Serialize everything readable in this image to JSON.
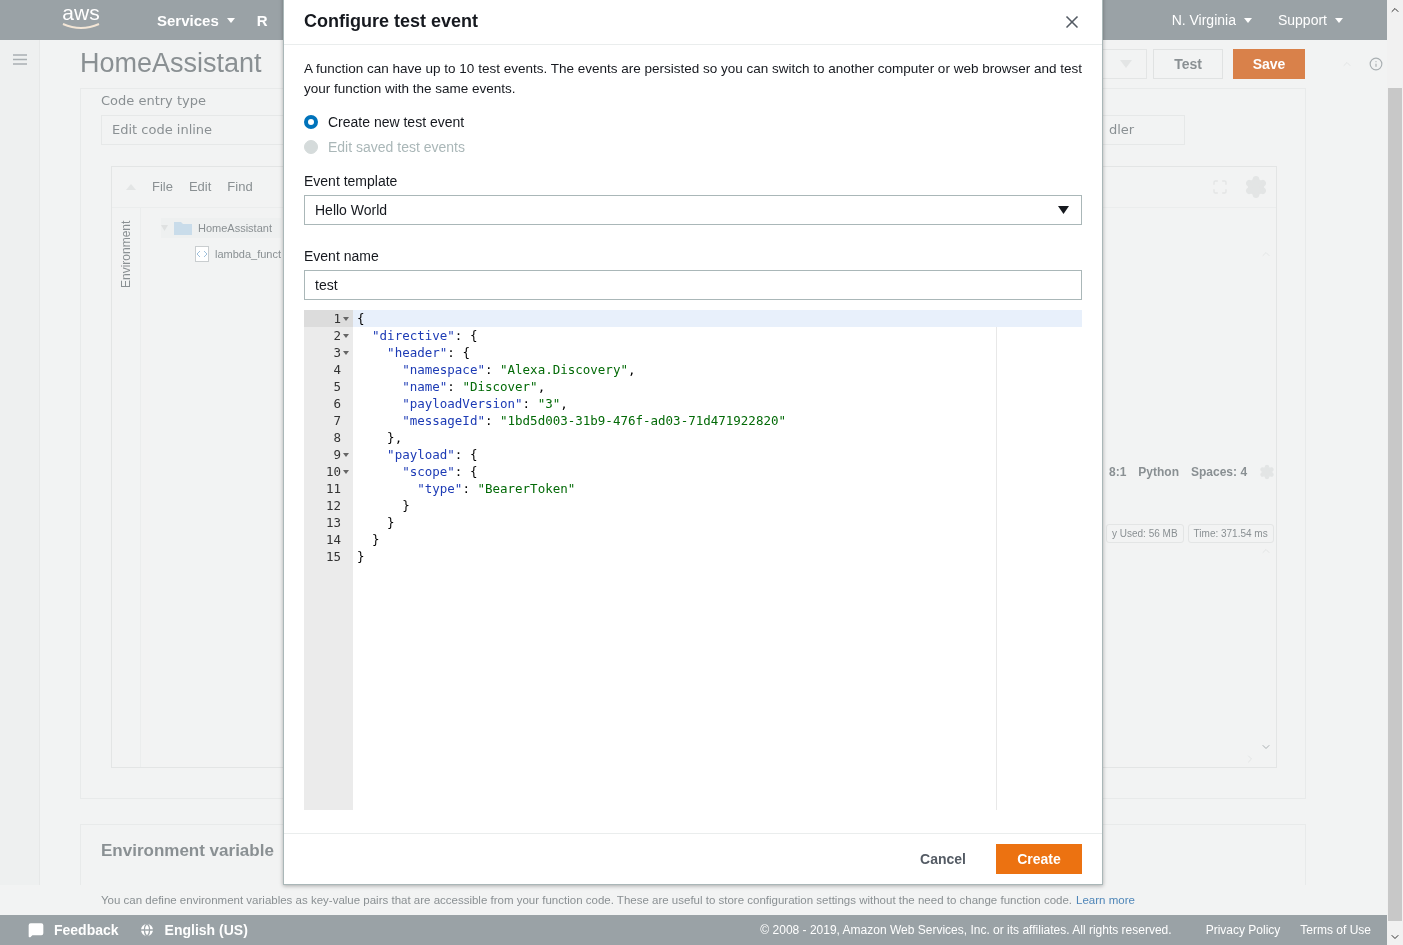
{
  "header": {
    "logo": "aws",
    "nav": [
      {
        "label": "Services",
        "caret": true
      },
      {
        "label": "R",
        "caret": false
      }
    ],
    "right": [
      {
        "label": "N. Virginia",
        "caret": true
      },
      {
        "label": "Support",
        "caret": true
      }
    ]
  },
  "page": {
    "title": "HomeAssistant",
    "actions": [
      {
        "kind": "select"
      },
      {
        "kind": "button",
        "label": "Test"
      },
      {
        "kind": "primary",
        "label": "Save"
      }
    ]
  },
  "code_card": {
    "entry_type_label": "Code entry type",
    "entry_type_value": "Edit code inline",
    "handler_value": "dler",
    "editor": {
      "menu": [
        "File",
        "Edit",
        "Find"
      ],
      "side_tab": "Environment",
      "tree": [
        {
          "label": "HomeAssistant",
          "kind": "folder",
          "expanded": true,
          "children": [
            {
              "label": "lambda_funct",
              "kind": "file"
            }
          ]
        }
      ],
      "status": [
        "8:1",
        "Python",
        "Spaces: 4"
      ],
      "result_chips": [
        "y Used: 56 MB",
        "Time: 371.54 ms"
      ]
    }
  },
  "env_card": {
    "title": "Environment variable",
    "description": "You can define environment variables as key-value pairs that are accessible from your function code. These are useful to store configuration settings without the need to change function code.",
    "link": "Learn more"
  },
  "footer": {
    "feedback": "Feedback",
    "language": "English (US)",
    "copyright": "© 2008 - 2019, Amazon Web Services, Inc. or its affiliates. All rights reserved.",
    "links": [
      "Privacy Policy",
      "Terms of Use"
    ]
  },
  "modal": {
    "title": "Configure test event",
    "intro": "A function can have up to 10 test events. The events are persisted so you can switch to another computer or web browser and test your function with the same events.",
    "options": [
      {
        "label": "Create new test event",
        "selected": true,
        "disabled": false
      },
      {
        "label": "Edit saved test events",
        "selected": false,
        "disabled": true
      }
    ],
    "template_label": "Event template",
    "template_value": "Hello World",
    "name_label": "Event name",
    "name_value": "test",
    "code": [
      {
        "n": "1",
        "text": "{",
        "fold": true,
        "active": true
      },
      {
        "n": "2",
        "text": "  \"directive\": {",
        "fold": true,
        "active": false
      },
      {
        "n": "3",
        "text": "    \"header\": {",
        "fold": true,
        "active": false
      },
      {
        "n": "4",
        "text": "      \"namespace\": \"Alexa.Discovery\",",
        "fold": false,
        "active": false
      },
      {
        "n": "5",
        "text": "      \"name\": \"Discover\",",
        "fold": false,
        "active": false
      },
      {
        "n": "6",
        "text": "      \"payloadVersion\": \"3\",",
        "fold": false,
        "active": false
      },
      {
        "n": "7",
        "text": "      \"messageId\": \"1bd5d003-31b9-476f-ad03-71d471922820\"",
        "fold": false,
        "active": false
      },
      {
        "n": "8",
        "text": "    },",
        "fold": false,
        "active": false
      },
      {
        "n": "9",
        "text": "    \"payload\": {",
        "fold": true,
        "active": false
      },
      {
        "n": "10",
        "text": "      \"scope\": {",
        "fold": true,
        "active": false
      },
      {
        "n": "11",
        "text": "        \"type\": \"BearerToken\"",
        "fold": false,
        "active": false
      },
      {
        "n": "12",
        "text": "      }",
        "fold": false,
        "active": false
      },
      {
        "n": "13",
        "text": "    }",
        "fold": false,
        "active": false
      },
      {
        "n": "14",
        "text": "  }",
        "fold": false,
        "active": false
      },
      {
        "n": "15",
        "text": "}",
        "fold": false,
        "active": false
      }
    ],
    "buttons": [
      {
        "label": "Cancel",
        "kind": "link"
      },
      {
        "label": "Create",
        "kind": "primary"
      }
    ]
  }
}
